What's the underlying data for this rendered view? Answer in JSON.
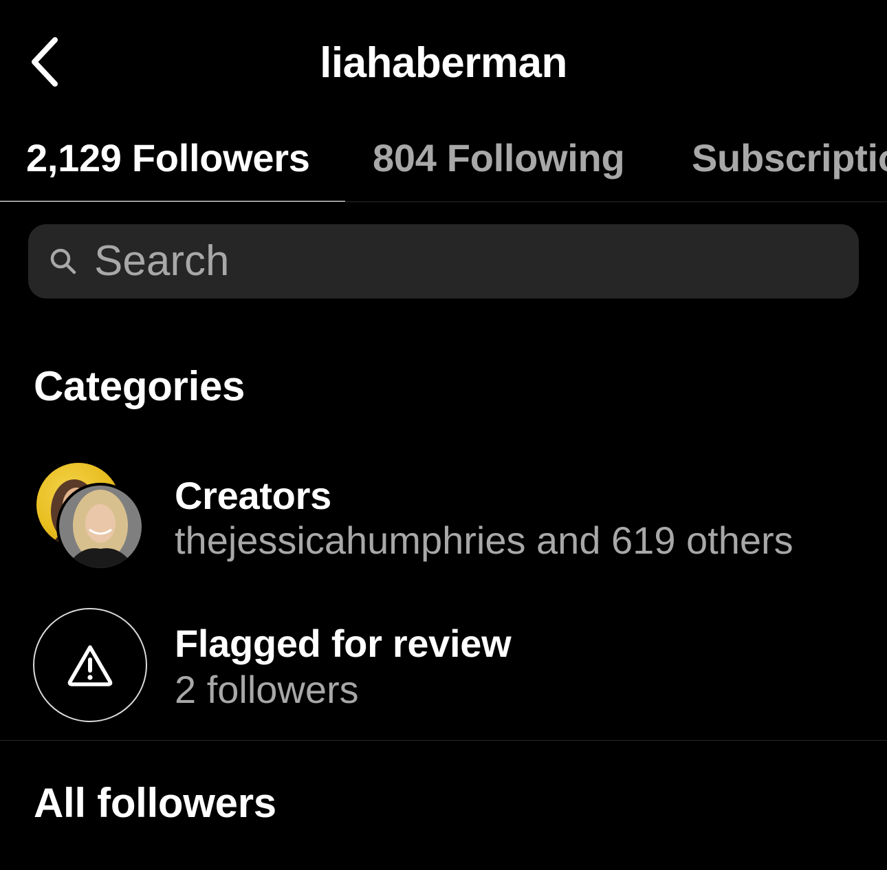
{
  "header": {
    "title": "liahaberman",
    "back_icon": "chevron-left-icon"
  },
  "tabs": [
    {
      "label": "2,129 Followers",
      "active": true
    },
    {
      "label": "804 Following",
      "active": false
    },
    {
      "label": "Subscriptio",
      "active": false
    }
  ],
  "search": {
    "placeholder": "Search",
    "icon": "search-icon"
  },
  "categories": {
    "heading": "Categories",
    "items": [
      {
        "title": "Creators",
        "subtitle": "thejessicahumphries and 619 others",
        "icon": "avatar-stack"
      },
      {
        "title": "Flagged for review",
        "subtitle": "2 followers",
        "icon": "warning-triangle-icon"
      }
    ]
  },
  "all_followers": {
    "heading": "All followers"
  },
  "colors": {
    "background": "#000000",
    "text_primary": "#ffffff",
    "text_secondary": "#a8a8a8",
    "search_bg": "#262626"
  }
}
